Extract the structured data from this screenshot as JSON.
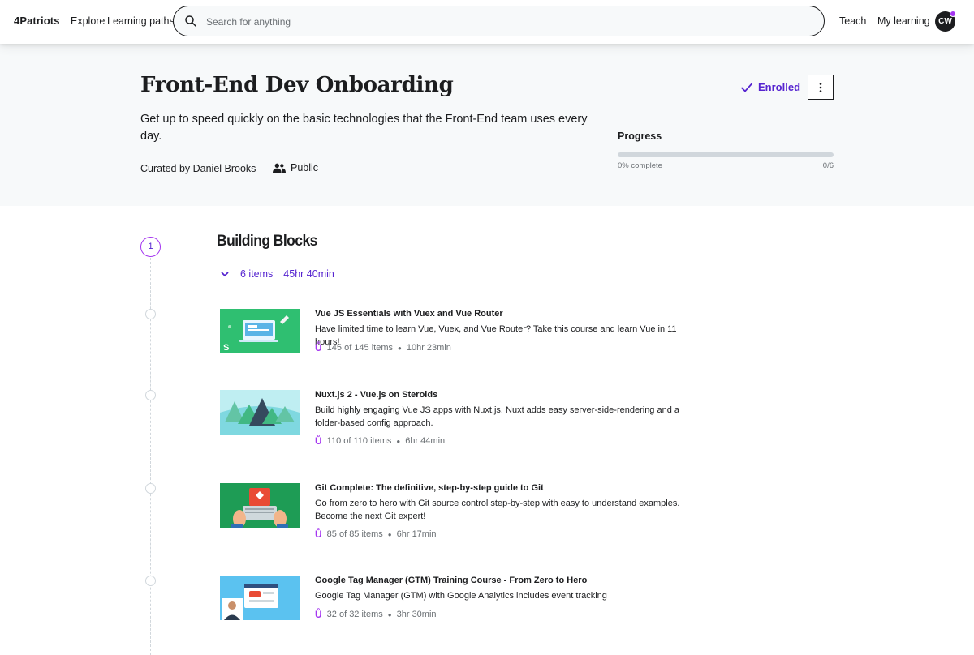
{
  "header": {
    "logo": "4Patriots",
    "nav": [
      "Explore",
      "Learning paths"
    ],
    "search_placeholder": "Search for anything",
    "teach": "Teach",
    "my_learning": "My learning",
    "avatar_initials": "CW"
  },
  "path": {
    "title": "Front-End Dev Onboarding",
    "description": "Get up to speed quickly on the basic technologies that the Front-End team uses every day.",
    "curated_by": "Curated by Daniel Brooks",
    "visibility": "Public",
    "enrolled_label": "Enrolled",
    "progress_label": "Progress",
    "progress_text": "0% complete",
    "progress_count": "0/6",
    "progress_fraction": 0
  },
  "section": {
    "number": "1",
    "title": "Building Blocks",
    "items_count": "6 items",
    "duration": "45hr 40min"
  },
  "courses": [
    {
      "title": "Vue JS Essentials with Vuex and Vue Router",
      "description": "Have limited time to learn Vue, Vuex, and Vue Router? Take this course and learn Vue in 11 hours!",
      "items": "145 of 145 items",
      "duration": "10hr 23min"
    },
    {
      "title": "Nuxt.js 2 - Vue.js on Steroids",
      "description": "Build highly engaging Vue JS apps with Nuxt.js. Nuxt adds easy server-side-rendering and a folder-based config approach.",
      "items": "110 of 110 items",
      "duration": "6hr 44min"
    },
    {
      "title": "Git Complete: The definitive, step-by-step guide to Git",
      "description": "Go from zero to hero with Git source control step-by-step with easy to understand examples. Become the next Git expert!",
      "items": "85 of 85 items",
      "duration": "6hr 17min"
    },
    {
      "title": "Google Tag Manager (GTM) Training Course - From Zero to Hero",
      "description": "Google Tag Manager (GTM) with Google Analytics includes event tracking",
      "items": "32 of 32 items",
      "duration": "3hr 30min"
    }
  ],
  "colors": {
    "accent": "#5624d0",
    "accent_light": "#a435f0",
    "hero_bg": "#f7f9fa"
  }
}
